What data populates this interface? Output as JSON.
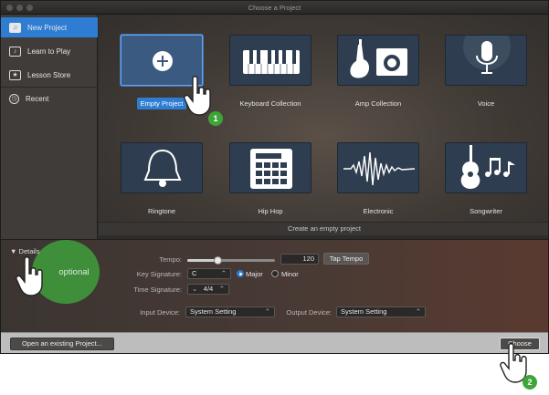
{
  "window": {
    "title": "Choose a Project"
  },
  "sidebar": {
    "items": [
      {
        "label": "New Project",
        "icon": "guitar-doc-icon"
      },
      {
        "label": "Learn to Play",
        "icon": "note-icon"
      },
      {
        "label": "Lesson Store",
        "icon": "star-icon"
      },
      {
        "label": "Recent",
        "icon": "clock-icon"
      }
    ]
  },
  "templates": [
    {
      "label": "Empty Project",
      "icon": "plus-circle-icon",
      "selected": true
    },
    {
      "label": "Keyboard Collection",
      "icon": "keyboard-icon"
    },
    {
      "label": "Amp Collection",
      "icon": "guitar-amp-icon"
    },
    {
      "label": "Voice",
      "icon": "microphone-icon"
    },
    {
      "label": "Ringtone",
      "icon": "bell-icon"
    },
    {
      "label": "Hip Hop",
      "icon": "drum-machine-icon"
    },
    {
      "label": "Electronic",
      "icon": "waveform-icon"
    },
    {
      "label": "Songwriter",
      "icon": "acoustic-guitar-icon"
    }
  ],
  "status": {
    "text": "Create an empty project"
  },
  "details": {
    "toggle_label": "Details",
    "optional_label": "optional",
    "tempo": {
      "label": "Tempo:",
      "value": "120",
      "tap_label": "Tap Tempo",
      "level": 0.35
    },
    "key_signature": {
      "label": "Key Signature:",
      "value": "C",
      "major": "Major",
      "minor": "Minor",
      "selected": "Major"
    },
    "time_signature": {
      "label": "Time Signature:",
      "value": "4/4"
    },
    "input_device": {
      "label": "Input Device:",
      "value": "System Setting"
    },
    "output_device": {
      "label": "Output Device:",
      "value": "System Setting"
    }
  },
  "footer": {
    "open_label": "Open an existing Project...",
    "choose_label": "Choose"
  },
  "annotations": [
    {
      "number": "1"
    },
    {
      "number": "2"
    }
  ],
  "colors": {
    "accent": "#2f7dd3",
    "badge": "#3ea53a",
    "optional": "#3f8f3a"
  }
}
